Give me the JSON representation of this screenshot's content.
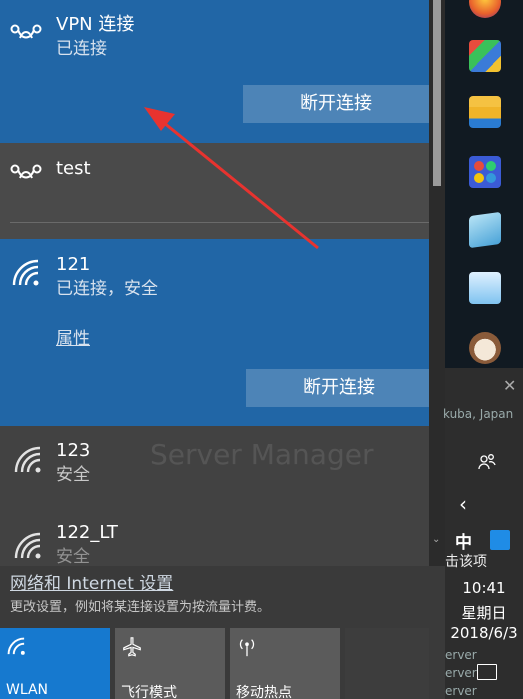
{
  "flyout": {
    "networks": [
      {
        "name": "VPN 连接",
        "status": "已连接",
        "button": "断开连接",
        "icon": "vpn-icon"
      },
      {
        "name": "test",
        "icon": "vpn-icon"
      },
      {
        "name": "121",
        "status": "已连接，安全",
        "properties_link": "属性",
        "button": "断开连接",
        "icon": "wifi-icon"
      },
      {
        "name": "123",
        "status": "安全",
        "icon": "wifi-icon"
      },
      {
        "name": "122_LT",
        "status": "安全",
        "icon": "wifi-icon"
      }
    ],
    "background_text": [
      "Server Manager"
    ],
    "settings_link": "网络和 Internet 设置",
    "settings_desc": "更改设置，例如将某连接设置为按流量计费。",
    "tiles": [
      {
        "label": "WLAN",
        "state": "on",
        "icon": "wifi-icon"
      },
      {
        "label": "飞行模式",
        "state": "off",
        "icon": "airplane-icon"
      },
      {
        "label": "移动热点",
        "state": "off",
        "icon": "hotspot-icon"
      }
    ]
  },
  "taskbar": {
    "ime": "中",
    "time": "10:41",
    "weekday": "星期日",
    "date": "2018/6/3",
    "bg_texts": [
      "kuba, Japan",
      "击该项",
      "erver"
    ]
  },
  "colors": {
    "accent": "#2166a6",
    "tile_on": "#1679cf",
    "tile_off": "#5b5b5b",
    "arrow": "#e8332f"
  }
}
